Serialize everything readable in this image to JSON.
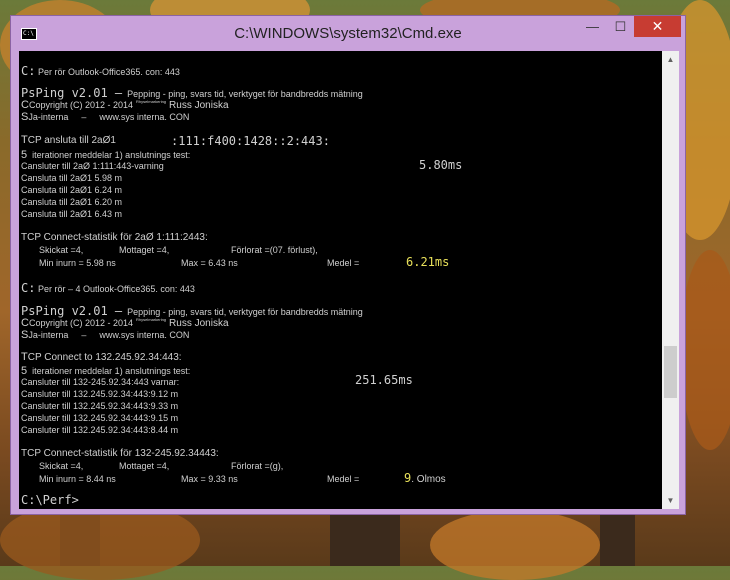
{
  "window": {
    "title": "C:\\WINDOWS\\system32\\Cmd.exe",
    "icon_label": "C:\\",
    "minimize_glyph": "—",
    "maximize_glyph": "☐",
    "close_glyph": "✕"
  },
  "scrollbar": {
    "up_glyph": "▲",
    "down_glyph": "▼"
  },
  "console": {
    "block1": {
      "prompt_prefix": "C:",
      "prompt_text": "Per rör Outlook-Office365. con: 443",
      "psping_title": "PsPing v2.01 –",
      "psping_desc": "Pepping - ping, svars tid, verktyget för bandbredds mätning",
      "c_letter": "C",
      "copyright": "Copyright (C) 2012 - 2014",
      "tiny_note": "Rhyselmarkering",
      "author": "Russ Joniska",
      "s_letter": "S",
      "sysinternals": "Ja-interna",
      "dash": "–",
      "url": "www.sys interna. CON",
      "tcp_header_a": "T",
      "tcp_header_b": "CP ansluta till 2aØ1",
      "tcp_addr": ":111:f400:1428::2:443:",
      "five": "5",
      "iterations": "iterationer meddelar 1) anslutnings test:",
      "warmup": "Cansluter till 2aØ 1:111:443-varning",
      "warmup_ms": "5.80ms",
      "rows": [
        "Cansluta till 2aØ1 5.98 m",
        "Cansluta till 2aØ1 6.24 m",
        "Cansluta till 2aØ1 6.20 m",
        "Cansluta till 2aØ1 6.43 m"
      ],
      "stats_header": "TCP Connect-statistik för 2aØ 1:111:2443:",
      "sent": "Skickat =4,",
      "received": "Mottaget =4,",
      "lost": "Förlorat =(07. förlust),",
      "min": "Min inurn = 5.98 ns",
      "max": "Max = 6.43 ns",
      "avg_label": "Medel =",
      "avg_value": "6.21ms"
    },
    "block2": {
      "prompt_prefix": "C:",
      "prompt_text": "Per rör – 4 Outlook-Office365. con: 443",
      "psping_title": "PsPing v2.01 –",
      "psping_desc": "Pepping - ping, svars tid, verktyget för bandbredds mätning",
      "c_letter": "C",
      "copyright": "Copyright (C) 2012 - 2014",
      "tiny_note": "Rhyselmarkering",
      "author": "Russ Joniska",
      "s_letter": "S",
      "sysinternals": "Ja-interna",
      "dash": "–",
      "url": "www.sys interna. CON",
      "tcp_header_a": "T",
      "tcp_header_b": "CP Connect to 132.245.92.34:443:",
      "five": "5",
      "iterations": "iterationer meddelar 1) anslutnings test:",
      "warmup": "Cansluter till 132-245.92.34:443 varnar:",
      "warmup_ms": "251.65ms",
      "rows": [
        "Cansluter till 132.245.92.34:443:9.12 m",
        "Cansluter till 132.245.92.34:443:9.33 m",
        "Cansluter till 132.245.92.34:443:9.15 m",
        "Cansluter till 132.245.92.34:443:8.44 m"
      ],
      "stats_header": "TCP Connect-statistik för 132-245.92.34443:",
      "sent": "Skickat =4,",
      "received": "Mottaget =4,",
      "lost": "Förlorat =(g),",
      "min": "Min inurn = 8.44 ns",
      "max": "Max = 9.33 ns",
      "avg_label": "Medel =",
      "avg_value": "9",
      "avg_suffix": ". Olmos"
    },
    "final_prompt": "C:\\Perf>"
  }
}
